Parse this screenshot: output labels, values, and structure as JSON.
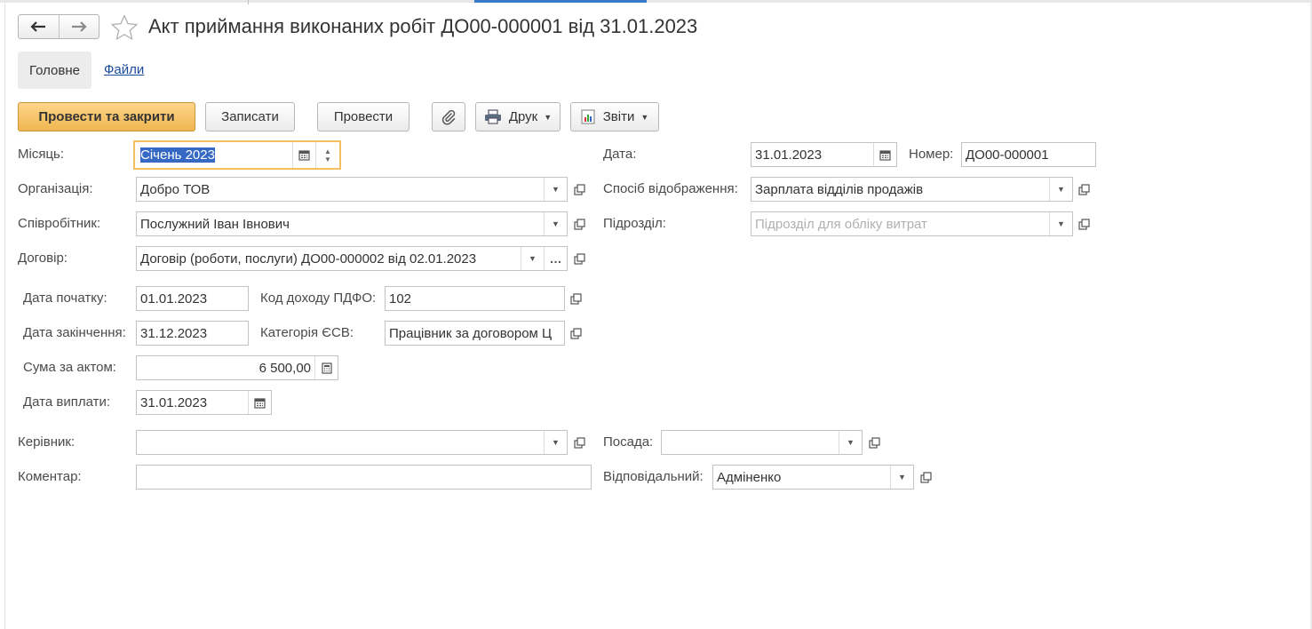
{
  "window": {
    "title": "Акт приймання виконаних робіт ДО00-000001 від 31.01.2023"
  },
  "nav": {
    "back_icon": "arrow-left-icon",
    "forward_icon": "arrow-right-icon",
    "favorite_icon": "star-icon"
  },
  "tabs": {
    "main": "Головне",
    "files": "Файли"
  },
  "toolbar": {
    "post_close": "Провести та закрити",
    "save": "Записати",
    "post": "Провести",
    "attach_icon": "paperclip-icon",
    "print": "Друк",
    "reports": "Звіти"
  },
  "form": {
    "month": {
      "label": "Місяць:",
      "value": "Січень 2023"
    },
    "organization": {
      "label": "Організація:",
      "value": "Добро ТОВ"
    },
    "employee": {
      "label": "Співробітник:",
      "value": "Послужний Іван Івнович"
    },
    "contract": {
      "label": "Договір:",
      "value": "Договір (роботи, послуги) ДО00-000002 від 02.01.2023"
    },
    "date": {
      "label": "Дата:",
      "value": "31.01.2023"
    },
    "number": {
      "label": "Номер:",
      "value": "ДО00-000001"
    },
    "display_method": {
      "label": "Спосіб відображення:",
      "value": "Зарплата відділів продажів"
    },
    "department": {
      "label": "Підрозділ:",
      "placeholder": "Підрозділ для обліку витрат"
    },
    "start_date": {
      "label": "Дата початку:",
      "value": "01.01.2023"
    },
    "end_date": {
      "label": "Дата закінчення:",
      "value": "31.12.2023"
    },
    "income_code": {
      "label": "Код доходу ПДФО:",
      "value": "102"
    },
    "esv_category": {
      "label": "Категорія ЄСВ:",
      "value": "Працівник за договором Ц"
    },
    "act_sum": {
      "label": "Сума за актом:",
      "value": "6 500,00"
    },
    "payment_date": {
      "label": "Дата виплати:",
      "value": "31.01.2023"
    },
    "manager": {
      "label": "Керівник:",
      "value": ""
    },
    "position": {
      "label": "Посада:",
      "value": ""
    },
    "comment": {
      "label": "Коментар:",
      "value": ""
    },
    "responsible": {
      "label": "Відповідальний:",
      "value": "Адміненко"
    }
  },
  "colors": {
    "primary_button": "#f0b550",
    "focus_border": "#f3bf60",
    "selection": "#3569c4",
    "link": "#1a4c9c"
  }
}
